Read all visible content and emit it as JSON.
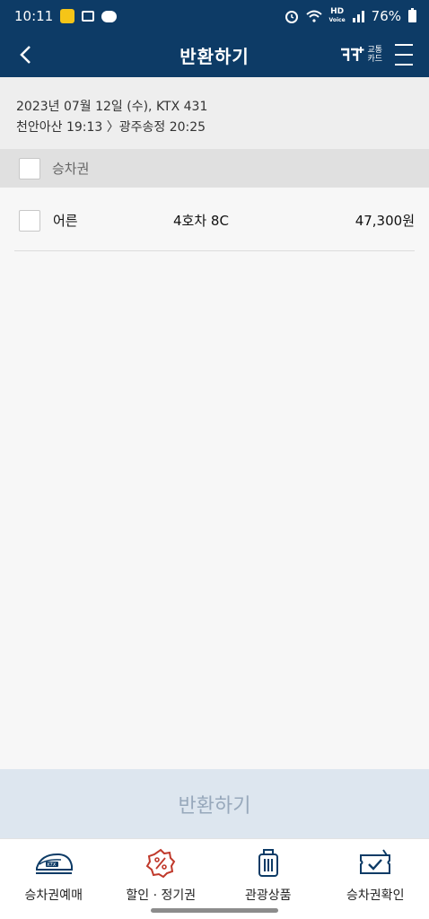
{
  "status_bar": {
    "time": "10:11",
    "battery": "76%",
    "network_badge_line1": "HD",
    "network_badge_line2": "Voice"
  },
  "app_bar": {
    "title": "반환하기",
    "card_label_line1": "교통",
    "card_label_line2": "카드",
    "card_logo": "코레일",
    "icons": [
      "back-arrow-icon",
      "transit-card-icon",
      "hamburger-menu-icon"
    ]
  },
  "trip": {
    "line1": "2023년 07월 12일 (수), KTX 431",
    "line2": "천안아산 19:13 〉광주송정 20:25"
  },
  "select_all": {
    "label": "승차권",
    "checked": false
  },
  "tickets": [
    {
      "type": "어른",
      "seat": "4호차 8C",
      "price": "47,300원",
      "checked": false
    }
  ],
  "return_button": {
    "label": "반환하기",
    "enabled": false
  },
  "bottom_nav": [
    {
      "label": "승차권예매",
      "icon": "ktx-train-icon"
    },
    {
      "label": "할인 · 정기권",
      "icon": "discount-gear-icon"
    },
    {
      "label": "관광상품",
      "icon": "luggage-icon"
    },
    {
      "label": "승차권확인",
      "icon": "ticket-check-icon"
    }
  ],
  "colors": {
    "header": "#0d3b66",
    "accent_red": "#c0392b",
    "button_disabled_bg": "#dde6ef",
    "button_disabled_text": "#97a8bb"
  }
}
